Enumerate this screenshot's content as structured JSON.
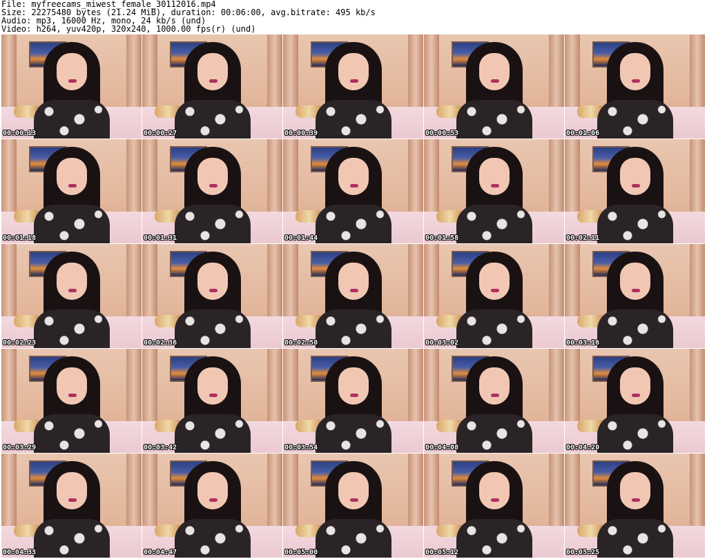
{
  "header": {
    "file": "File: myfreecams_miwest_female_30112016.mp4",
    "size": "Size: 22275480 bytes (21.24 MiB), duration: 00:06:00, avg.bitrate: 495 kb/s",
    "audio": "Audio: mp3, 16000 Hz, mono, 24 kb/s (und)",
    "video": "Video: h264, yuv420p, 320x240, 1000.00 fps(r) (und)"
  },
  "thumbnails": [
    {
      "time": "00:00:13"
    },
    {
      "time": "00:00:27"
    },
    {
      "time": "00:00:39"
    },
    {
      "time": "00:00:53"
    },
    {
      "time": "00:01:06"
    },
    {
      "time": "00:01:18"
    },
    {
      "time": "00:01:31"
    },
    {
      "time": "00:01:44"
    },
    {
      "time": "00:01:58"
    },
    {
      "time": "00:02:11"
    },
    {
      "time": "00:02:23"
    },
    {
      "time": "00:02:36"
    },
    {
      "time": "00:02:50"
    },
    {
      "time": "00:03:02"
    },
    {
      "time": "00:03:16"
    },
    {
      "time": "00:03:29"
    },
    {
      "time": "00:03:42"
    },
    {
      "time": "00:03:54"
    },
    {
      "time": "00:04:08"
    },
    {
      "time": "00:04:20"
    },
    {
      "time": "00:04:33"
    },
    {
      "time": "00:04:47"
    },
    {
      "time": "00:05:00"
    },
    {
      "time": "00:05:12"
    },
    {
      "time": "00:05:25"
    }
  ]
}
